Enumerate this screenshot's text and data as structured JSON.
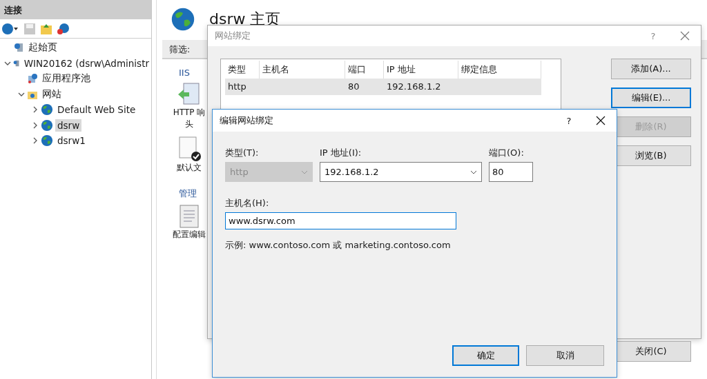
{
  "connections": {
    "title": "连接",
    "toolbar": [
      {
        "kind": "connect",
        "disabled": false
      },
      {
        "kind": "save",
        "disabled": true
      },
      {
        "kind": "up",
        "disabled": false
      },
      {
        "kind": "disconnect",
        "disabled": false
      }
    ],
    "tree": [
      {
        "label": "起始页",
        "kind": "start",
        "selected": false
      },
      {
        "label": "WIN20162 (dsrw\\Administr",
        "kind": "server",
        "selected": false,
        "expanded": true,
        "children": [
          {
            "label": "应用程序池",
            "kind": "pool",
            "selected": false
          },
          {
            "label": "网站",
            "kind": "sites",
            "selected": false,
            "expanded": true,
            "children": [
              {
                "label": "Default Web Site",
                "kind": "site",
                "selected": false,
                "expanded": false
              },
              {
                "label": "dsrw",
                "kind": "site",
                "selected": true,
                "expanded": false
              },
              {
                "label": "dsrw1",
                "kind": "site",
                "selected": false,
                "expanded": false
              }
            ]
          }
        ]
      }
    ]
  },
  "home": {
    "title": "dsrw 主页",
    "filter_label": "筛选:",
    "sections": [
      {
        "label": "IIS",
        "features": [
          {
            "kind": "http-headers",
            "lines": [
              "HTTP 响",
              "头"
            ]
          },
          {
            "kind": "default-document",
            "lines": [
              "默认文"
            ]
          }
        ]
      },
      {
        "label": "管理",
        "features": [
          {
            "kind": "config-editor",
            "lines": [
              "配置编辑"
            ]
          }
        ]
      }
    ]
  },
  "bindings_dialog": {
    "title": "网站绑定",
    "help": "?",
    "columns": [
      "类型",
      "主机名",
      "端口",
      "IP 地址",
      "绑定信息"
    ],
    "rows": [
      {
        "type": "http",
        "port": "80",
        "ip_address": "192.168.1.2",
        "selected": true
      }
    ],
    "buttons": [
      {
        "label": "添加(A)...",
        "disabled": false,
        "focused": false
      },
      {
        "label": "编辑(E)...",
        "disabled": false,
        "focused": true
      },
      {
        "label": "删除(R)",
        "disabled": true,
        "focused": false
      },
      {
        "label": "浏览(B)",
        "disabled": false,
        "focused": false
      }
    ],
    "close_button": "关闭(C)"
  },
  "edit_dialog": {
    "title": "编辑网站绑定",
    "help": "?",
    "type": {
      "label": "类型(T):",
      "value": "http",
      "disabled": true
    },
    "ip_address": {
      "label": "IP 地址(I):",
      "value": "192.168.1.2"
    },
    "port": {
      "label": "端口(O):",
      "value": "80"
    },
    "host_name": {
      "label": "主机名(H):",
      "value": "www.dsrw.com",
      "focused": true
    },
    "example": "示例: www.contoso.com 或 marketing.contoso.com",
    "buttons": [
      {
        "label": "确定",
        "default": true
      },
      {
        "label": "取消",
        "default": false
      }
    ]
  }
}
